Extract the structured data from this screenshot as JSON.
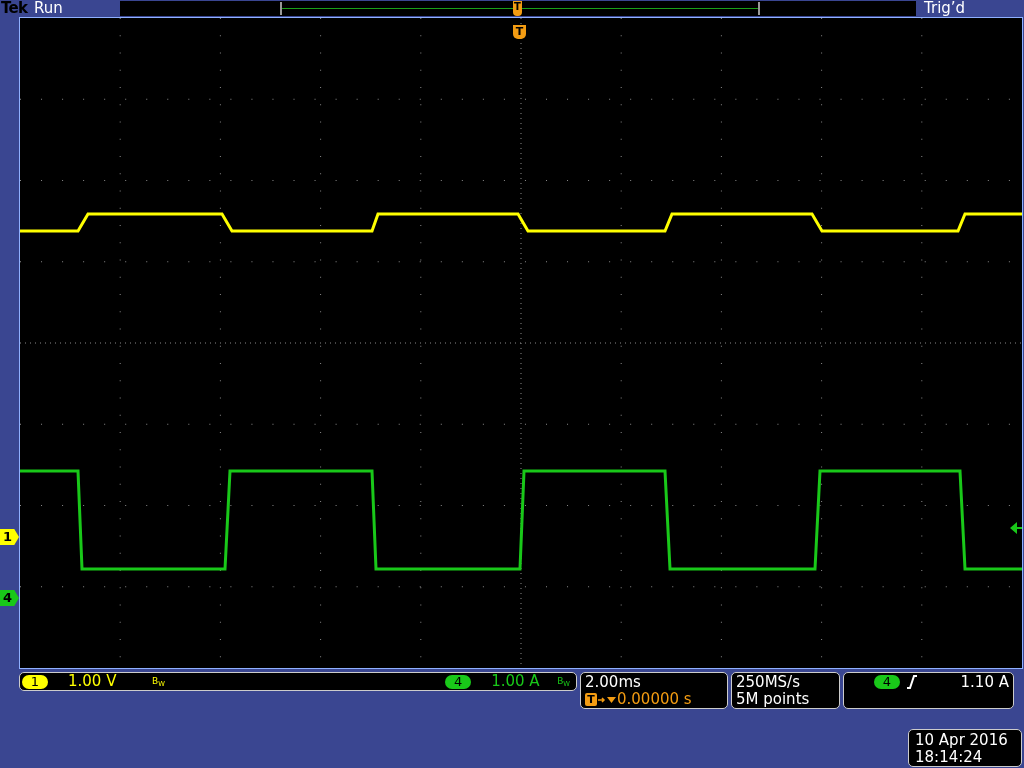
{
  "top_bar": {
    "brand": "Tek",
    "run_state": "Run",
    "trigger_status": "Trig’d"
  },
  "record_view": {
    "trigger_marker": "T"
  },
  "graticule": {
    "trigger_marker": "T",
    "channel_markers": [
      {
        "label": "1",
        "color": "#ffff00"
      },
      {
        "label": "4",
        "color": "#19c819"
      }
    ]
  },
  "channels": [
    {
      "number": "1",
      "scale": "1.00 V",
      "bw_limit": "B$_{W}$",
      "color": "#ffff00"
    },
    {
      "number": "4",
      "scale": "1.00 A",
      "bw_limit": "B$_{W}$",
      "color": "#19c819"
    }
  ],
  "timebase": {
    "scale": "2.00ms",
    "trigger_icon": "T",
    "position": "0.00000 s"
  },
  "acquisition": {
    "sample_rate": "250MS/s",
    "record_length": "5M points"
  },
  "trigger": {
    "source": "4",
    "level": "1.10 A"
  },
  "date_time": {
    "date": "10 Apr 2016",
    "time": "18:14:24"
  }
}
